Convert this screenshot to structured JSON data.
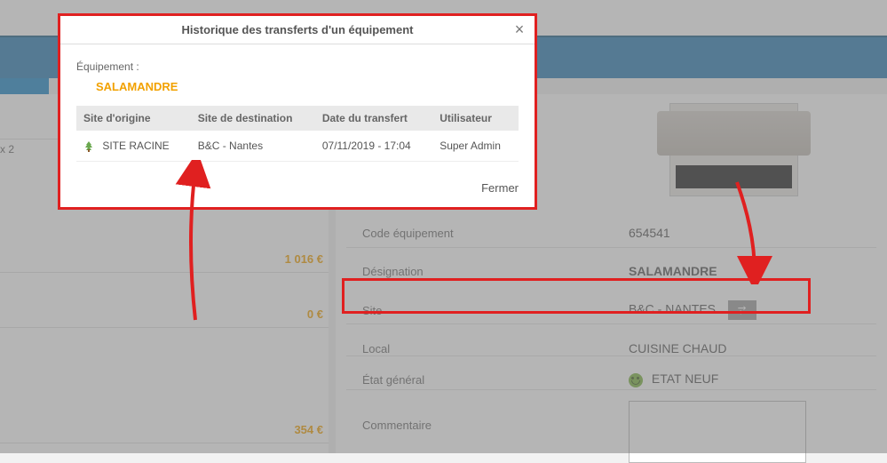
{
  "modal": {
    "title": "Historique des transferts d'un équipement",
    "equip_label": "Équipement :",
    "equip_name": "SALAMANDRE",
    "columns": {
      "c1": "Site d'origine",
      "c2": "Site de destination",
      "c3": "Date du transfert",
      "c4": "Utilisateur"
    },
    "rows": [
      {
        "origin": "SITE RACINE",
        "dest": "B&C - Nantes",
        "date": "07/11/2019 - 17:04",
        "user": "Super Admin"
      }
    ],
    "close_label": "Fermer"
  },
  "left": {
    "x2": "x 2",
    "amounts": {
      "a1": "1 016 €",
      "a2": "0 €",
      "a3": "354 €"
    }
  },
  "detail": {
    "code_label": "Code équipement",
    "code_value": "654541",
    "desig_label": "Désignation",
    "desig_value": "SALAMANDRE",
    "site_label": "Site",
    "site_value": "B&C - NANTES",
    "local_label": "Local",
    "local_value": "CUISINE CHAUD",
    "etat_label": "État général",
    "etat_value": "ETAT NEUF",
    "comm_label": "Commentaire"
  }
}
